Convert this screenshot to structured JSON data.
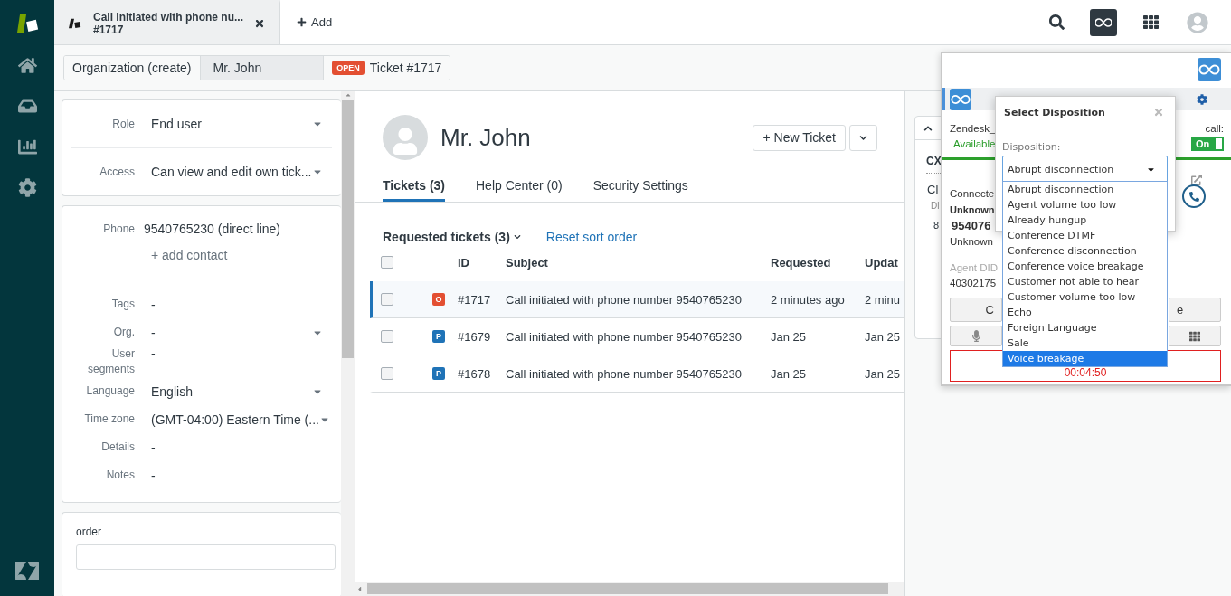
{
  "top_tabs": [
    {
      "title": "Call initiated with phone nu...",
      "subtitle": "#1717",
      "selected": true
    }
  ],
  "add_tab": "Add",
  "breadcrumbs": [
    {
      "label": "Organization (create)",
      "selected": false
    },
    {
      "label": "Mr. John",
      "selected": true
    },
    {
      "label": "Ticket #1717",
      "badge": "OPEN",
      "selected": false
    }
  ],
  "user_card": [
    {
      "label": "Role",
      "value": "End user",
      "kind": "select"
    },
    {
      "label": "Access",
      "value": "Can view and edit own tick...",
      "kind": "select"
    }
  ],
  "contact": {
    "label": "Phone",
    "value": "9540765230 (direct line)",
    "add_link": "+ add contact"
  },
  "details": [
    {
      "label": "Tags",
      "value": "-",
      "kind": "text"
    },
    {
      "label": "Org.",
      "value": "-",
      "kind": "select"
    },
    {
      "label": "User segments",
      "value": "-",
      "kind": "text"
    },
    {
      "label": "Language",
      "value": "English",
      "kind": "select"
    },
    {
      "label": "Time zone",
      "value": "(GMT-04:00) Eastern Time (...",
      "kind": "select"
    },
    {
      "label": "Details",
      "value": "-",
      "kind": "text"
    },
    {
      "label": "Notes",
      "value": "-",
      "kind": "text"
    }
  ],
  "custom_field": {
    "label": "order"
  },
  "profile": {
    "name": "Mr. John",
    "new_ticket": "+ New Ticket"
  },
  "profile_tabs": [
    {
      "label": "Tickets (3)",
      "selected": true
    },
    {
      "label": "Help Center (0)",
      "selected": false
    },
    {
      "label": "Security Settings",
      "selected": false
    }
  ],
  "tickets": {
    "view": "Requested tickets (3)",
    "reset": "Reset sort order",
    "all_checked": false,
    "columns": [
      "ID",
      "Subject",
      "Requested",
      "Updat"
    ],
    "rows": [
      {
        "status": "O",
        "color": "#e34f32",
        "id": "#1717",
        "subject": "Call initiated with phone number 9540765230",
        "requested": "2 minutes ago",
        "updated": "2 minu",
        "checked": false,
        "selected": true
      },
      {
        "status": "P",
        "color": "#1f73b7",
        "id": "#1679",
        "subject": "Call initiated with phone number 9540765230",
        "requested": "Jan 25",
        "updated": "Jan 25",
        "checked": false,
        "selected": false
      },
      {
        "status": "P",
        "color": "#1f73b7",
        "id": "#1678",
        "subject": "Call initiated with phone number 9540765230",
        "requested": "Jan 25",
        "updated": "Jan 25",
        "checked": false,
        "selected": false
      }
    ]
  },
  "app_panel": {
    "section": "CX",
    "line_1": "Cl",
    "line_2": "Di",
    "line_3": "8"
  },
  "ameyo": {
    "agent": "Zendesk_",
    "call_label": "call:",
    "status": "Available",
    "toggle": {
      "label": "On",
      "on": true
    },
    "connection": "Connecte",
    "caller": "Unknown",
    "number": "954076",
    "caller_type": "Unknown",
    "did_label": "Agent DID",
    "did": "40302175",
    "button_left": "C",
    "button_right": "e",
    "timer": "00:04:50"
  },
  "disposition": {
    "title": "Select Disposition",
    "label": "Disposition:",
    "value": "Abrupt disconnection",
    "options": [
      {
        "label": "Abrupt disconnection",
        "highlighted": false
      },
      {
        "label": "Agent volume too low",
        "highlighted": false
      },
      {
        "label": "Already hungup",
        "highlighted": false
      },
      {
        "label": "Conference DTMF",
        "highlighted": false
      },
      {
        "label": "Conference disconnection",
        "highlighted": false
      },
      {
        "label": "Conference voice breakage",
        "highlighted": false
      },
      {
        "label": "Customer not able to hear",
        "highlighted": false
      },
      {
        "label": "Customer volume too low",
        "highlighted": false
      },
      {
        "label": "Echo",
        "highlighted": false
      },
      {
        "label": "Foreign Language",
        "highlighted": false
      },
      {
        "label": "Sale",
        "highlighted": false
      },
      {
        "label": "Voice breakage",
        "highlighted": true
      }
    ]
  }
}
